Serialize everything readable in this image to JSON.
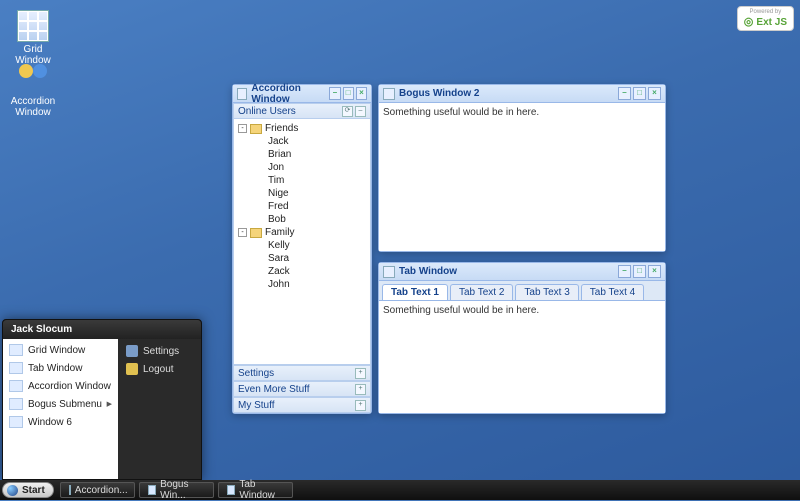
{
  "desktop_icons": [
    {
      "name": "grid-window",
      "label": "Grid Window"
    },
    {
      "name": "accordion-window",
      "label": "Accordion Window"
    }
  ],
  "extjs": {
    "powered": "Powered by",
    "brand": "Ext JS"
  },
  "windows": {
    "accordion": {
      "title": "Accordion Window",
      "panels": {
        "online_users": {
          "title": "Online Users",
          "groups": [
            {
              "name": "Friends",
              "children": [
                "Jack",
                "Brian",
                "Jon",
                "Tim",
                "Nige",
                "Fred",
                "Bob"
              ]
            },
            {
              "name": "Family",
              "children": [
                "Kelly",
                "Sara",
                "Zack",
                "John"
              ]
            }
          ]
        },
        "collapsed": [
          "Settings",
          "Even More Stuff",
          "My Stuff"
        ]
      }
    },
    "bogus2": {
      "title": "Bogus Window 2",
      "content": "Something useful would be in here."
    },
    "tabwin": {
      "title": "Tab Window",
      "tabs": [
        "Tab Text 1",
        "Tab Text 2",
        "Tab Text 3",
        "Tab Text 4"
      ],
      "active_tab": 0,
      "content": "Something useful would be in here."
    }
  },
  "start_menu": {
    "user": "Jack Slocum",
    "items": [
      {
        "label": "Grid Window"
      },
      {
        "label": "Tab Window"
      },
      {
        "label": "Accordion Window"
      },
      {
        "label": "Bogus Submenu",
        "submenu": true
      },
      {
        "label": "Window 6"
      }
    ],
    "tools": [
      {
        "label": "Settings",
        "icon": "settings"
      },
      {
        "label": "Logout",
        "icon": "logout"
      }
    ]
  },
  "taskbar": {
    "start": "Start",
    "buttons": [
      "Accordion...",
      "Bogus Win...",
      "Tab Window"
    ]
  }
}
